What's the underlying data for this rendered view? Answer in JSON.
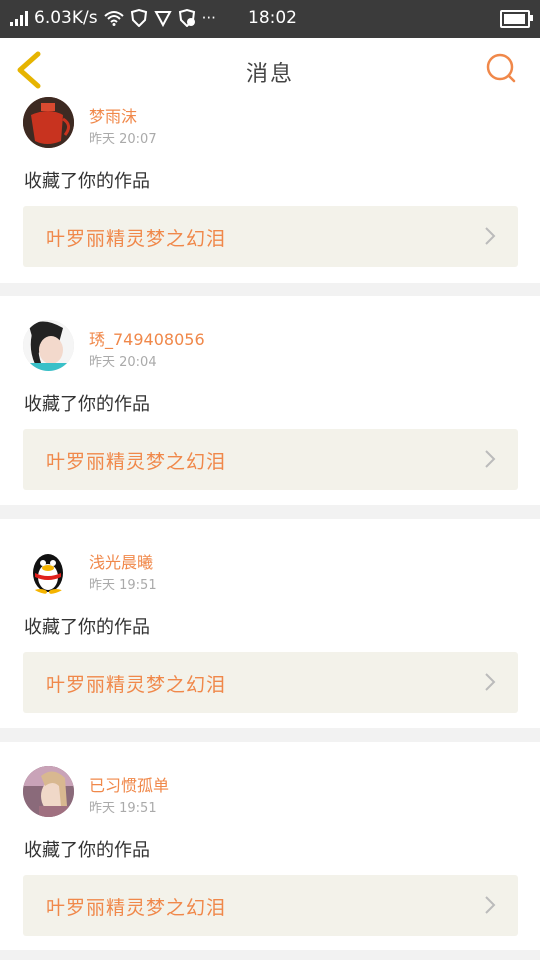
{
  "status_bar": {
    "speed": "6.03K/s",
    "time": "18:02",
    "more": "···"
  },
  "header": {
    "title": "消息"
  },
  "messages": [
    {
      "name": "梦雨沫",
      "time": "昨天 20:07",
      "action": "收藏了你的作品",
      "work_title": "叶罗丽精灵梦之幻泪"
    },
    {
      "name": "琇_749408056",
      "time": "昨天 20:04",
      "action": "收藏了你的作品",
      "work_title": "叶罗丽精灵梦之幻泪"
    },
    {
      "name": "浅光晨曦",
      "time": "昨天 19:51",
      "action": "收藏了你的作品",
      "work_title": "叶罗丽精灵梦之幻泪"
    },
    {
      "name": "已习惯孤单",
      "time": "昨天 19:51",
      "action": "收藏了你的作品",
      "work_title": "叶罗丽精灵梦之幻泪"
    }
  ],
  "colors": {
    "accent": "#f0884a",
    "card_bg": "#f3f2ea",
    "status_bg": "#3b3b3b",
    "back_icon": "#e6b400"
  },
  "icons": {
    "back": "chevron-left-icon",
    "search": "search-icon",
    "row_arrow": "chevron-right-icon"
  }
}
